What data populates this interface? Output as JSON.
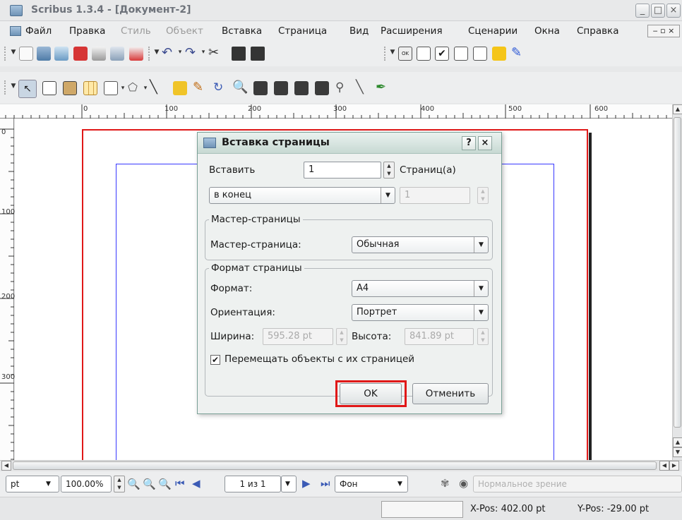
{
  "window": {
    "title": "Scribus 1.3.4 - [Документ-2]",
    "min": "_",
    "max": "□",
    "close": "×"
  },
  "menu": [
    "Файл",
    "Правка",
    "Стиль",
    "Объект",
    "Вставка",
    "Страница",
    "Вид",
    "Расширения",
    "Сценарии",
    "Окна",
    "Справка"
  ],
  "menu_disabled": [
    "Стиль",
    "Объект"
  ],
  "menu_right_controls": "‒ ▫ ×",
  "toolbar1_icons": [
    "new-document-icon",
    "open-folder-icon",
    "save-icon",
    "close-document-icon",
    "print-icon",
    "preflight-icon",
    "export-pdf-icon",
    "undo-icon",
    "redo-icon",
    "cut-icon",
    "copy-icon",
    "paste-icon",
    "pdf-button-icon",
    "pdf-text-field-icon",
    "pdf-checkbox-icon",
    "pdf-combobox-icon",
    "pdf-listbox-icon",
    "pdf-text-annotation-icon",
    "pdf-link-annotation-icon"
  ],
  "toolbar2_icons": [
    "select-arrow-icon",
    "text-frame-icon",
    "image-frame-icon",
    "table-icon",
    "rectangle-icon",
    "polygon-icon",
    "line-icon",
    "bezier-icon",
    "freehand-icon",
    "rotate-icon",
    "zoom-icon",
    "edit-contents-icon",
    "edit-text-icon",
    "link-frames-icon",
    "unlink-frames-icon",
    "measure-icon",
    "copy-properties-icon",
    "eyedropper-icon"
  ],
  "ruler_h_labels": [
    "0",
    "100",
    "200",
    "300",
    "400",
    "500",
    "600"
  ],
  "ruler_v_labels": [
    "0",
    "100",
    "200",
    "300"
  ],
  "dialog": {
    "title": "Вставка страницы",
    "help": "?",
    "close": "×",
    "insert_label": "Вставить",
    "insert_count": "1",
    "pages_label": "Страниц(а)",
    "position": "в конец",
    "page_number": "1",
    "master_group": "Мастер-страницы",
    "master_label": "Мастер-страница:",
    "master_value": "Обычная",
    "format_group": "Формат страницы",
    "format_label": "Формат:",
    "format_value": "A4",
    "orientation_label": "Ориентация:",
    "orientation_value": "Портрет",
    "width_label": "Ширина:",
    "width_value": "595.28 pt",
    "height_label": "Высота:",
    "height_value": "841.89 pt",
    "move_objects_label": "Перемещать объекты с их страницей",
    "move_objects_checked": true,
    "ok": "OK",
    "cancel": "Отменить",
    "highlight_color": "#e01818"
  },
  "status": {
    "unit": "pt",
    "zoom": "100.00%",
    "page": "1 из 1",
    "layer": "Фон",
    "view_mode": "Нормальное зрение",
    "x_pos": "X-Pos: 402.00 pt",
    "y_pos": "Y-Pos: -29.00 pt"
  },
  "colors": {
    "page_border": "#e01818",
    "margin_guides": "#3838ff",
    "dialog_bg": "#eef1f0"
  }
}
